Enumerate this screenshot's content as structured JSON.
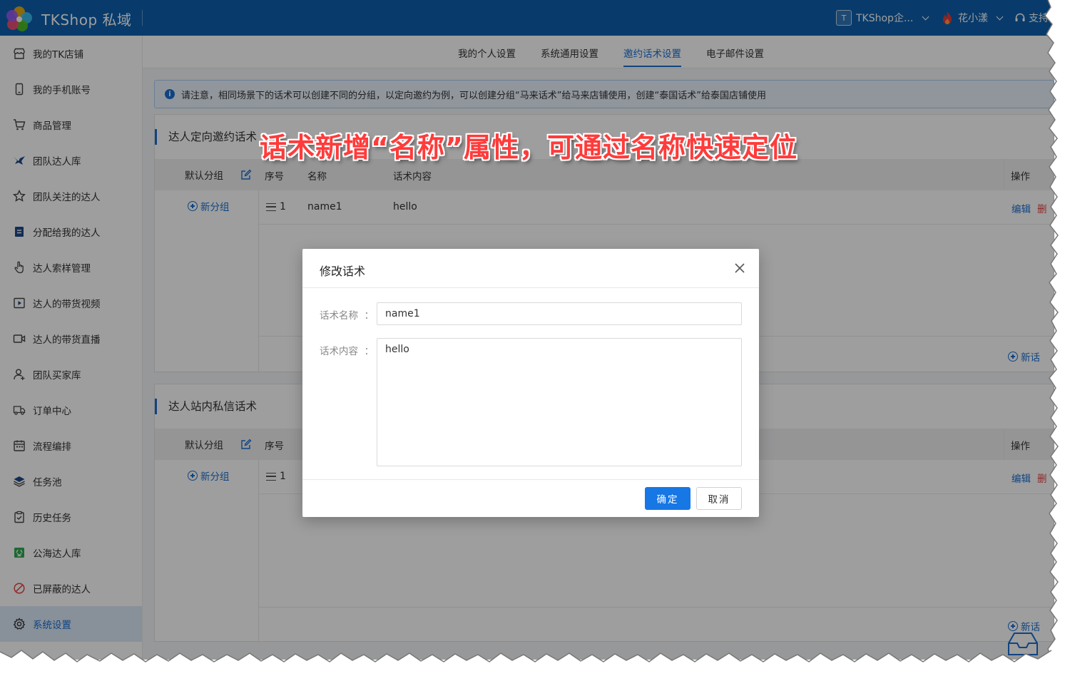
{
  "header": {
    "brand": "TKShop 私域",
    "shop_avatar_letter": "T",
    "shop_name": "TKShop企...",
    "user_name": "花小漾",
    "support": "支持"
  },
  "sidebar": {
    "items": [
      {
        "label": "我的TK店铺",
        "icon": "shop-icon"
      },
      {
        "label": "我的手机账号",
        "icon": "phone-icon"
      },
      {
        "label": "商品管理",
        "icon": "cart-icon"
      },
      {
        "label": "团队达人库",
        "icon": "bird-icon"
      },
      {
        "label": "团队关注的达人",
        "icon": "star-icon"
      },
      {
        "label": "分配给我的达人",
        "icon": "assigned-icon"
      },
      {
        "label": "达人索样管理",
        "icon": "hand-pointer-icon"
      },
      {
        "label": "达人的带货视频",
        "icon": "video-icon"
      },
      {
        "label": "达人的带货直播",
        "icon": "live-icon"
      },
      {
        "label": "团队买家库",
        "icon": "buyer-icon"
      },
      {
        "label": "订单中心",
        "icon": "truck-icon"
      },
      {
        "label": "流程编排",
        "icon": "calendar-icon"
      },
      {
        "label": "任务池",
        "icon": "layers-icon"
      },
      {
        "label": "历史任务",
        "icon": "clipboard-icon"
      },
      {
        "label": "公海达人库",
        "icon": "public-icon"
      },
      {
        "label": "已屏蔽的达人",
        "icon": "block-icon"
      },
      {
        "label": "系统设置",
        "icon": "gear-icon",
        "active": true
      }
    ]
  },
  "tabs": [
    {
      "label": "我的个人设置"
    },
    {
      "label": "系统通用设置"
    },
    {
      "label": "邀约话术设置",
      "active": true
    },
    {
      "label": "电子邮件设置"
    }
  ],
  "notice": "请注意，相同场景下的话术可以创建不同的分组，以定向邀约为例，可以创建分组“马来话术”给马来店铺使用，创建“泰国话术”给泰国店铺使用",
  "panel1": {
    "title": "达人定向邀约话术",
    "group_header": "默认分组",
    "add_group": "新分组",
    "columns": {
      "index": "序号",
      "name": "名称",
      "content": "话术内容",
      "ops": "操作"
    },
    "rows": [
      {
        "index": "1",
        "name": "name1",
        "content": "hello",
        "edit": "编辑",
        "del": "删"
      }
    ],
    "add_script": "新话"
  },
  "panel2": {
    "title": "达人站内私信话术",
    "group_header": "默认分组",
    "add_group": "新分组",
    "columns": {
      "index": "序号",
      "ops": "操作"
    },
    "rows": [
      {
        "index": "1",
        "edit": "编辑",
        "del": "删"
      }
    ],
    "add_script": "新话"
  },
  "modal": {
    "title": "修改话术",
    "name_label": "话术名称",
    "name_value": "name1",
    "content_label": "话术内容",
    "content_value": "hello",
    "ok": "确定",
    "cancel": "取消"
  },
  "annotation": "话术新增“名称”属性，可通过名称快速定位",
  "colors": {
    "header_bg": "#0e60ad",
    "accent": "#1a6fd1",
    "primary_button": "#1677e5",
    "danger": "#e54545",
    "annotation": "#ff3b3b"
  }
}
